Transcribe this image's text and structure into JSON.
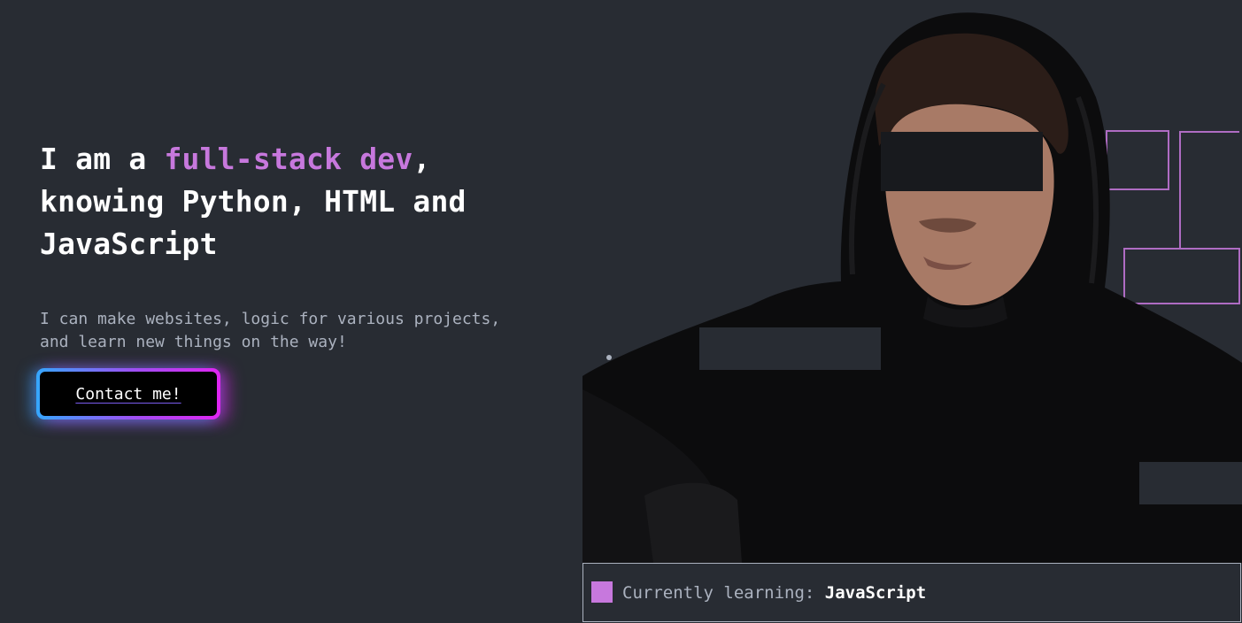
{
  "hero": {
    "headline_prefix": "I am a ",
    "headline_accent": "full-stack dev",
    "headline_line1_end": ",",
    "headline_line2": "knowing Python, HTML and",
    "headline_line3": "JavaScript",
    "subtitle_line1": "I can make websites, logic for various projects,",
    "subtitle_line2": "and learn new things on the way!",
    "cta_label": "Contact me!"
  },
  "status": {
    "prefix": "Currently learning: ",
    "value": "JavaScript"
  },
  "colors": {
    "background": "#282c33",
    "accent": "#c778dd",
    "text": "#ffffff",
    "muted": "#abb2bf",
    "gradient_start": "#35a7ff",
    "gradient_end": "#e025f2"
  }
}
